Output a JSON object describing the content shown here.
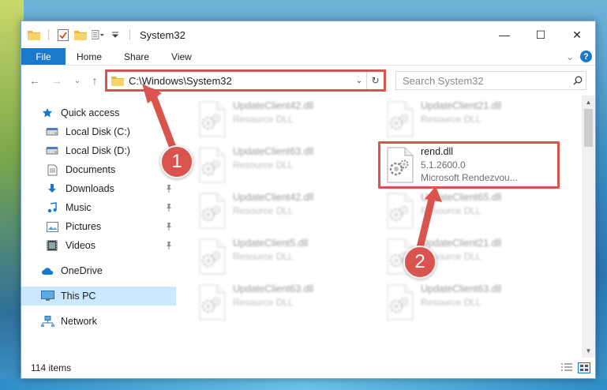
{
  "window": {
    "title": "System32",
    "controls": {
      "minimize": "—",
      "maximize": "☐",
      "close": "✕"
    }
  },
  "ribbon": {
    "tabs": [
      "File",
      "Home",
      "Share",
      "View"
    ],
    "expand_glyph": "⌄",
    "help_glyph": "?"
  },
  "navbar": {
    "back_glyph": "←",
    "forward_glyph": "→",
    "recent_glyph": "⌄",
    "up_glyph": "↑",
    "address": "C:\\Windows\\System32",
    "address_dropdown_glyph": "⌄",
    "refresh_glyph": "↻",
    "search_placeholder": "Search System32"
  },
  "sidebar": {
    "items": [
      {
        "label": "Quick access",
        "icon": "star-icon",
        "pinned": false
      },
      {
        "label": "Local Disk (C:)",
        "icon": "drive-icon",
        "pinned": false
      },
      {
        "label": "Local Disk (D:)",
        "icon": "drive-icon",
        "pinned": false
      },
      {
        "label": "Documents",
        "icon": "documents-icon",
        "pinned": true
      },
      {
        "label": "Downloads",
        "icon": "download-icon",
        "pinned": true
      },
      {
        "label": "Music",
        "icon": "music-icon",
        "pinned": true
      },
      {
        "label": "Pictures",
        "icon": "pictures-icon",
        "pinned": true
      },
      {
        "label": "Videos",
        "icon": "videos-icon",
        "pinned": true
      },
      {
        "label": "OneDrive",
        "icon": "cloud-icon",
        "pinned": false
      },
      {
        "label": "This PC",
        "icon": "computer-icon",
        "pinned": false,
        "selected": true
      },
      {
        "label": "Network",
        "icon": "network-icon",
        "pinned": false
      }
    ]
  },
  "files": [
    {
      "name": "UpdateClient42.dll",
      "desc": "Resource DLL",
      "col": 0,
      "row": 0
    },
    {
      "name": "UpdateClient21.dll",
      "desc": "Resource DLL",
      "col": 1,
      "row": 0
    },
    {
      "name": "UpdateClient63.dll",
      "desc": "Resource DLL",
      "col": 0,
      "row": 1
    },
    {
      "name": "rend.dll",
      "desc": "5.1.2600.0",
      "desc2": "Microsoft Rendezvou...",
      "col": 1,
      "row": 1,
      "highlight": true
    },
    {
      "name": "UpdateClient42.dll",
      "desc": "Resource DLL",
      "col": 0,
      "row": 2
    },
    {
      "name": "UpdateClient65.dll",
      "desc": "Resource DLL",
      "col": 1,
      "row": 2
    },
    {
      "name": "UpdateClient5.dll",
      "desc": "Resource DLL",
      "col": 0,
      "row": 3
    },
    {
      "name": "UpdateClient21.dll",
      "desc": "Resource DLL",
      "col": 1,
      "row": 3
    },
    {
      "name": "UpdateClient63.dll",
      "desc": "Resource DLL",
      "col": 0,
      "row": 4
    },
    {
      "name": "UpdateClient63.dll",
      "desc": "Resource DLL",
      "col": 1,
      "row": 4
    }
  ],
  "status": {
    "item_count": "114 items"
  },
  "callouts": [
    "1",
    "2"
  ],
  "colors": {
    "accent": "#1979ca",
    "highlight": "#d9534f",
    "selected": "#cce8ff"
  }
}
